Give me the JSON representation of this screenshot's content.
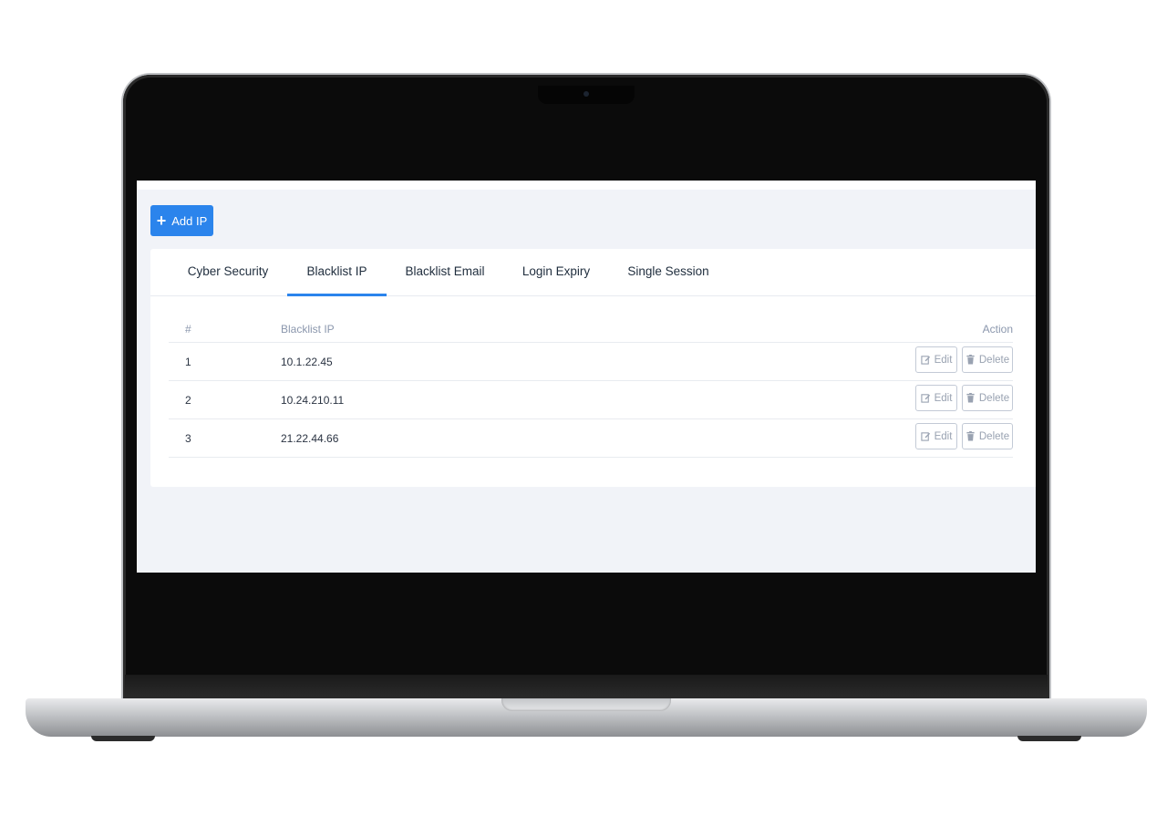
{
  "toolbar": {
    "add_label": "Add IP"
  },
  "tabs": [
    {
      "label": "Cyber Security",
      "active": false
    },
    {
      "label": "Blacklist IP",
      "active": true
    },
    {
      "label": "Blacklist Email",
      "active": false
    },
    {
      "label": "Login Expiry",
      "active": false
    },
    {
      "label": "Single Session",
      "active": false
    }
  ],
  "table": {
    "headers": {
      "num": "#",
      "ip": "Blacklist IP",
      "action": "Action"
    },
    "rows": [
      {
        "num": "1",
        "ip": "10.1.22.45"
      },
      {
        "num": "2",
        "ip": "10.24.210.11"
      },
      {
        "num": "3",
        "ip": "21.22.44.66"
      }
    ],
    "edit_label": "Edit",
    "delete_label": "Delete"
  },
  "colors": {
    "accent": "#2b84ec",
    "screen_bg": "#f1f3f8",
    "muted": "#99a2b1"
  }
}
